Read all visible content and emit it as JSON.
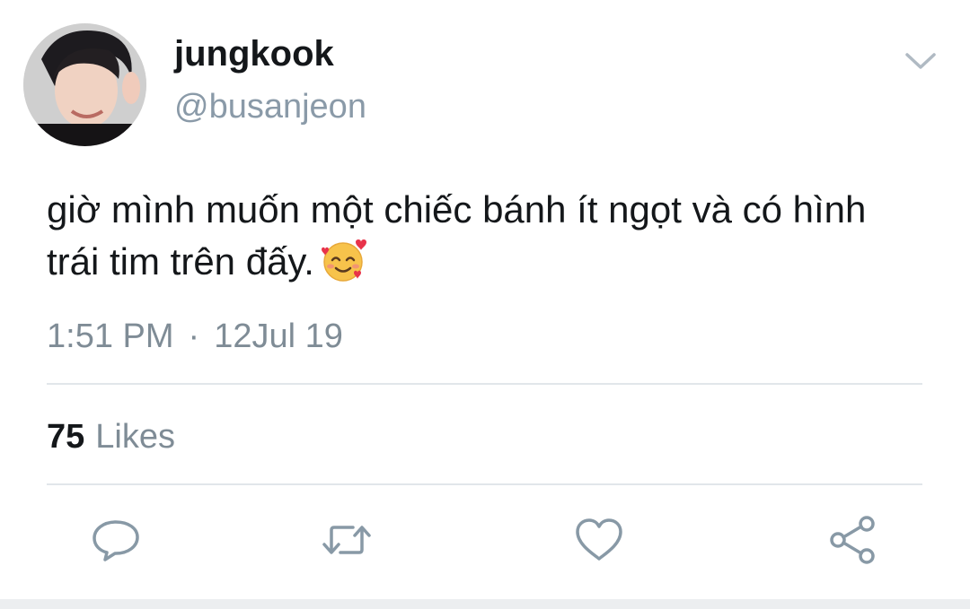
{
  "user": {
    "display_name": "jungkook",
    "handle": "@busanjeon",
    "avatar": "profile-photo"
  },
  "tweet": {
    "text_line1": "giờ mình muốn một chiếc bánh ít ngọt và có hình",
    "text_line2": "trái tim trên đấy.",
    "emoji": "smiling-face-with-hearts-emoji",
    "time": "1:51 PM",
    "separator": "·",
    "date": "12Jul 19"
  },
  "stats": {
    "likes_count": "75",
    "likes_label": "Likes"
  },
  "actions": [
    "reply-icon",
    "retweet-icon",
    "heart-icon",
    "share-icon"
  ],
  "colors": {
    "text": "#14171a",
    "secondary": "#8a9aa8",
    "divider": "#e1e6ea",
    "icon": "#8899a6"
  }
}
